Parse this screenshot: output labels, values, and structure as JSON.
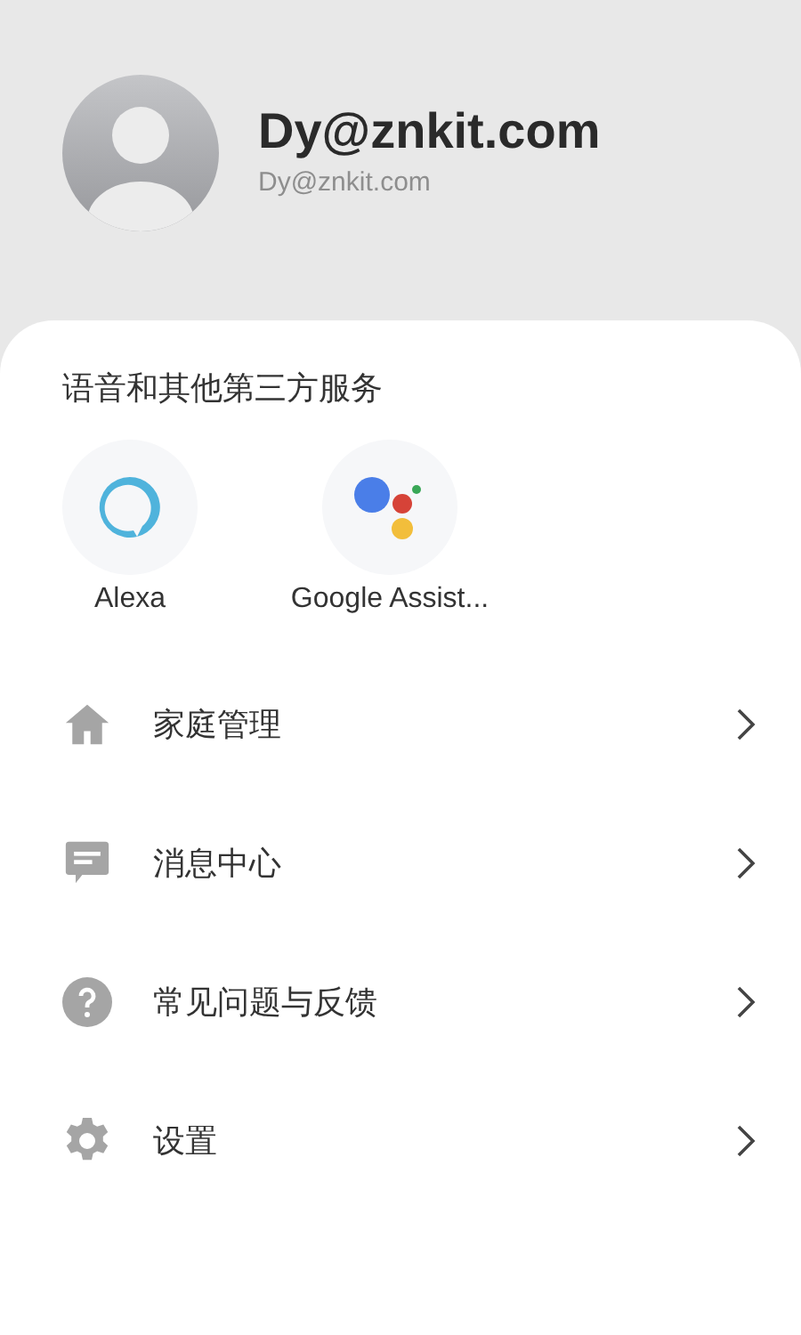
{
  "profile": {
    "name": "Dy@znkit.com",
    "email": "Dy@znkit.com"
  },
  "services": {
    "title": "语音和其他第三方服务",
    "items": [
      {
        "kind": "alexa",
        "label": "Alexa"
      },
      {
        "kind": "google",
        "label": "Google Assist..."
      }
    ]
  },
  "menu": [
    {
      "kind": "home",
      "label": "家庭管理"
    },
    {
      "kind": "message",
      "label": "消息中心"
    },
    {
      "kind": "help",
      "label": "常见问题与反馈"
    },
    {
      "kind": "settings",
      "label": "设置"
    }
  ]
}
